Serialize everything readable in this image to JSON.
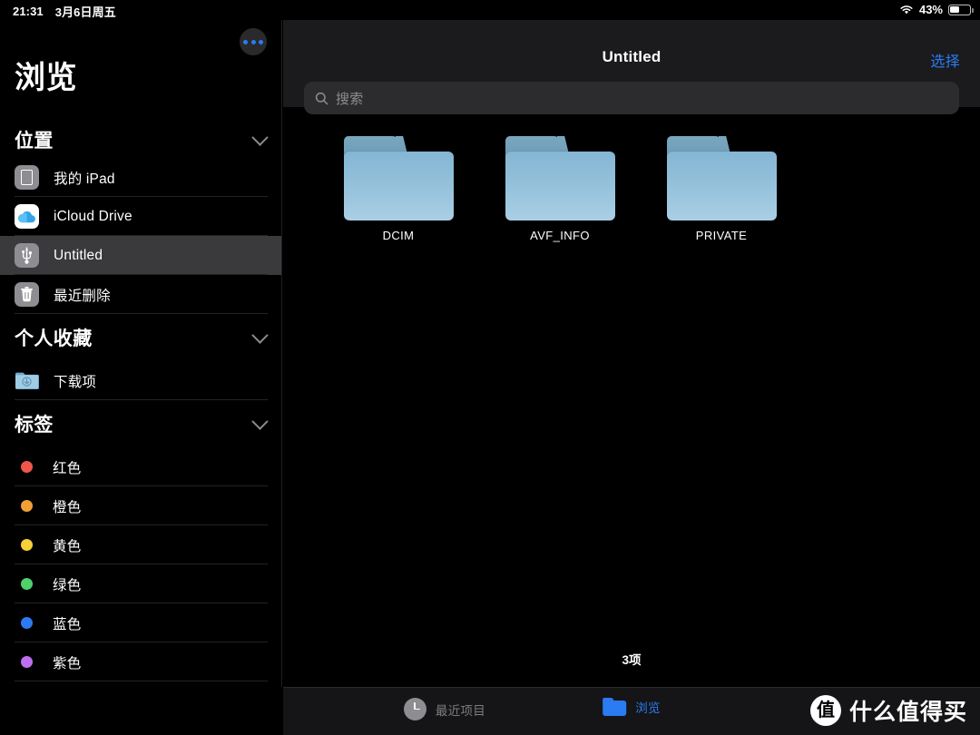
{
  "status_bar": {
    "time": "21:31",
    "date": "3月6日周五",
    "wifi_icon": "wifi-icon",
    "battery_percent": "43%",
    "battery_level": 43
  },
  "sidebar": {
    "more_button_icon": "more-ellipsis-icon",
    "title": "浏览",
    "sections": [
      {
        "title": "位置",
        "collapse_icon": "chevron-down-icon",
        "items": [
          {
            "label": "我的 iPad",
            "icon": "ipad-icon",
            "selected": false
          },
          {
            "label": "iCloud Drive",
            "icon": "icloud-icon",
            "selected": false
          },
          {
            "label": "Untitled",
            "icon": "usb-drive-icon",
            "selected": true
          },
          {
            "label": "最近删除",
            "icon": "trash-icon",
            "selected": false
          }
        ]
      },
      {
        "title": "个人收藏",
        "collapse_icon": "chevron-down-icon",
        "items": [
          {
            "label": "下载项",
            "icon": "downloads-folder-icon",
            "selected": false
          }
        ]
      },
      {
        "title": "标签",
        "collapse_icon": "chevron-down-icon",
        "items": [
          {
            "label": "红色",
            "icon": "tag-dot-icon",
            "color": "#f0564a"
          },
          {
            "label": "橙色",
            "icon": "tag-dot-icon",
            "color": "#f0a035"
          },
          {
            "label": "黄色",
            "icon": "tag-dot-icon",
            "color": "#f5d037"
          },
          {
            "label": "绿色",
            "icon": "tag-dot-icon",
            "color": "#4ed16a"
          },
          {
            "label": "蓝色",
            "icon": "tag-dot-icon",
            "color": "#2b7bf3"
          },
          {
            "label": "紫色",
            "icon": "tag-dot-icon",
            "color": "#c06ef0"
          }
        ]
      }
    ]
  },
  "content": {
    "title": "Untitled",
    "select_label": "选择",
    "search": {
      "icon": "search-icon",
      "placeholder": "搜索",
      "value": ""
    },
    "items": [
      {
        "name": "DCIM",
        "icon": "folder-icon"
      },
      {
        "name": "AVF_INFO",
        "icon": "folder-icon"
      },
      {
        "name": "PRIVATE",
        "icon": "folder-icon"
      }
    ],
    "item_count_label": "3项"
  },
  "tab_bar": {
    "tabs": [
      {
        "label": "最近项目",
        "icon": "clock-icon",
        "active": false
      },
      {
        "label": "浏览",
        "icon": "folder-icon",
        "active": true
      }
    ]
  },
  "watermark": {
    "logo_char": "值",
    "text": "什么值得买"
  },
  "colors": {
    "accent": "#2b7bf3",
    "sidebar_bg": "#000000",
    "panel_bg": "#1b1b1d",
    "selected_row": "#3a3a3c",
    "secondary_text": "#8e8e93"
  }
}
